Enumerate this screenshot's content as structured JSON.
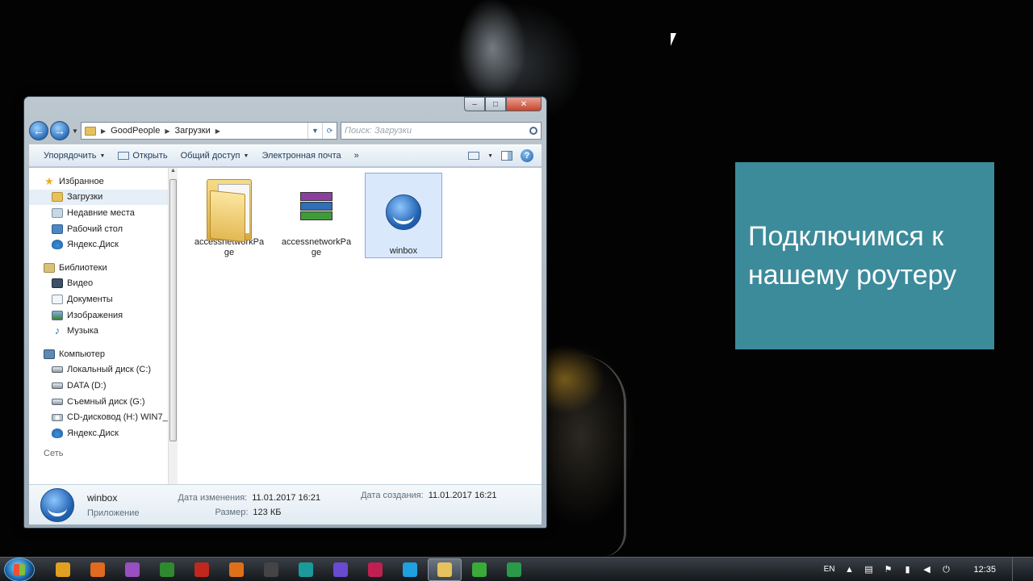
{
  "slide": {
    "line1": "Подключимся к",
    "line2": "нашему роутеру",
    "bg": "#3c8b9b"
  },
  "window": {
    "buttons": {
      "minimize": "‒",
      "maximize": "□",
      "close": "✕"
    },
    "address": {
      "crumbs": [
        "GoodPeople",
        "Загрузки"
      ]
    },
    "search": {
      "placeholder": "Поиск: Загрузки"
    },
    "toolbar": {
      "organize": "Упорядочить",
      "open": "Открыть",
      "share": "Общий доступ",
      "email": "Электронная почта",
      "more": "»"
    },
    "navpane": {
      "favorites": {
        "head": "Избранное",
        "items": [
          "Загрузки",
          "Недавние места",
          "Рабочий стол",
          "Яндекс.Диск"
        ]
      },
      "libraries": {
        "head": "Библиотеки",
        "items": [
          "Видео",
          "Документы",
          "Изображения",
          "Музыка"
        ]
      },
      "computer": {
        "head": "Компьютер",
        "items": [
          "Локальный диск (C:)",
          "DATA (D:)",
          "Съемный диск (G:)",
          "CD-дисковод (H:) WIN7_",
          "Яндекс.Диск"
        ]
      },
      "network": "Сеть"
    },
    "files": [
      {
        "name": "accessnetworkPage",
        "icon": "folder-icon"
      },
      {
        "name": "accessnetworkPage",
        "icon": "winrar-icon"
      },
      {
        "name": "winbox",
        "icon": "winbox-icon",
        "selected": true
      }
    ],
    "details": {
      "name": "winbox",
      "type": "Приложение",
      "modified_label": "Дата изменения:",
      "modified_value": "11.01.2017 16:21",
      "size_label": "Размер:",
      "size_value": "123 КБ",
      "created_label": "Дата создания:",
      "created_value": "11.01.2017 16:21"
    }
  },
  "taskbar": {
    "apps": [
      {
        "name": "chrome",
        "color": "#e0a020"
      },
      {
        "name": "firefox",
        "color": "#e06a20"
      },
      {
        "name": "app3",
        "color": "#9a4fc0"
      },
      {
        "name": "dreamweaver",
        "color": "#2f8a2f"
      },
      {
        "name": "filezilla",
        "color": "#c0281e"
      },
      {
        "name": "app6",
        "color": "#e07018"
      },
      {
        "name": "app7",
        "color": "#444444"
      },
      {
        "name": "arduino",
        "color": "#1a9a9a"
      },
      {
        "name": "app9",
        "color": "#6a4ad0"
      },
      {
        "name": "app10",
        "color": "#c02050"
      },
      {
        "name": "skype",
        "color": "#1fa0e0"
      },
      {
        "name": "explorer",
        "color": "#e6c25e"
      },
      {
        "name": "app13",
        "color": "#3aaa3a"
      },
      {
        "name": "app14",
        "color": "#2a9a4a"
      }
    ],
    "lang": "EN",
    "time": "12:35"
  }
}
